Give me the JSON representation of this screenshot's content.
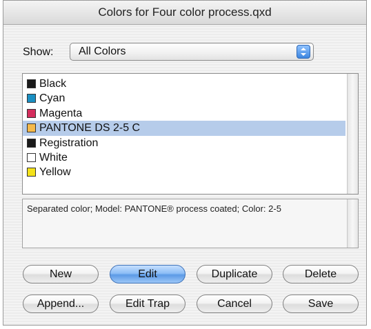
{
  "window": {
    "title": "Colors for Four color process.qxd"
  },
  "show": {
    "label": "Show:",
    "value": "All Colors"
  },
  "colors": [
    {
      "name": "Black",
      "swatch": "#1a1a1a"
    },
    {
      "name": "Cyan",
      "swatch": "#1a8fc2"
    },
    {
      "name": "Magenta",
      "swatch": "#d42d5c"
    },
    {
      "name": "PANTONE DS 2-5 C",
      "swatch": "#f5b94a"
    },
    {
      "name": "Registration",
      "swatch": "#1a1a1a"
    },
    {
      "name": "White",
      "swatch": "#ffffff"
    },
    {
      "name": "Yellow",
      "swatch": "#f4e21a"
    }
  ],
  "selected_color": "PANTONE DS 2-5 C",
  "info": {
    "text": "Separated color; Model: PANTONE® process coated; Color: 2-5"
  },
  "buttons": {
    "new": "New",
    "edit": "Edit",
    "duplicate": "Duplicate",
    "delete": "Delete",
    "append": "Append...",
    "edit_trap": "Edit Trap",
    "cancel": "Cancel",
    "save": "Save"
  },
  "accent_color": "#5c9ae6"
}
